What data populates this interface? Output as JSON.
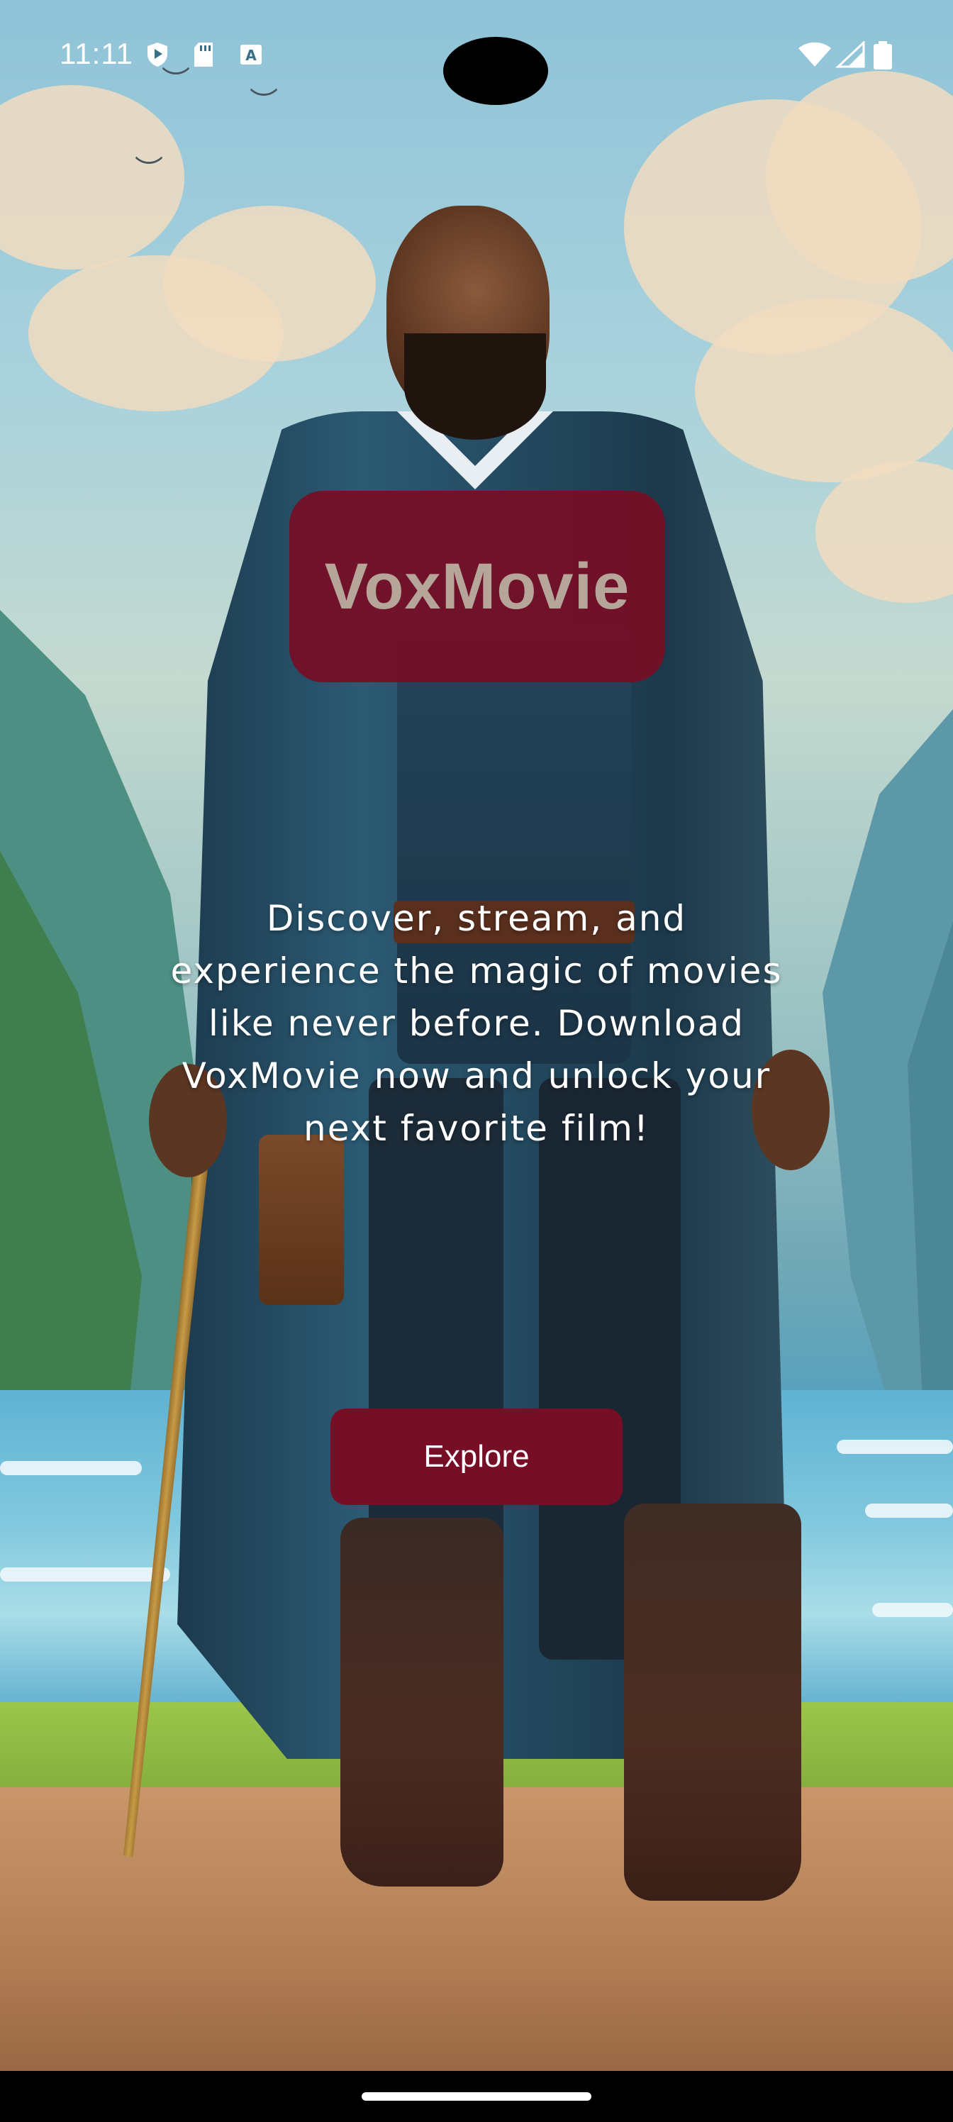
{
  "status_bar": {
    "time": "11:11",
    "left_icons": [
      "play-protect-icon",
      "sd-card-icon",
      "keyboard-a-icon"
    ],
    "right_icons": [
      "wifi-icon",
      "cellular-signal-icon",
      "battery-icon"
    ]
  },
  "app": {
    "name": "VoxMovie",
    "tagline": "Discover, stream, and experience the magic of movies like never before. Download VoxMovie now and unlock your next favorite film!",
    "primary_button_label": "Explore"
  },
  "colors": {
    "brand": "#760f26",
    "logo_text": "#b6a69a",
    "text_on_image": "#ffffff"
  },
  "background": {
    "type": "illustration",
    "icon": "hero-illustration"
  }
}
